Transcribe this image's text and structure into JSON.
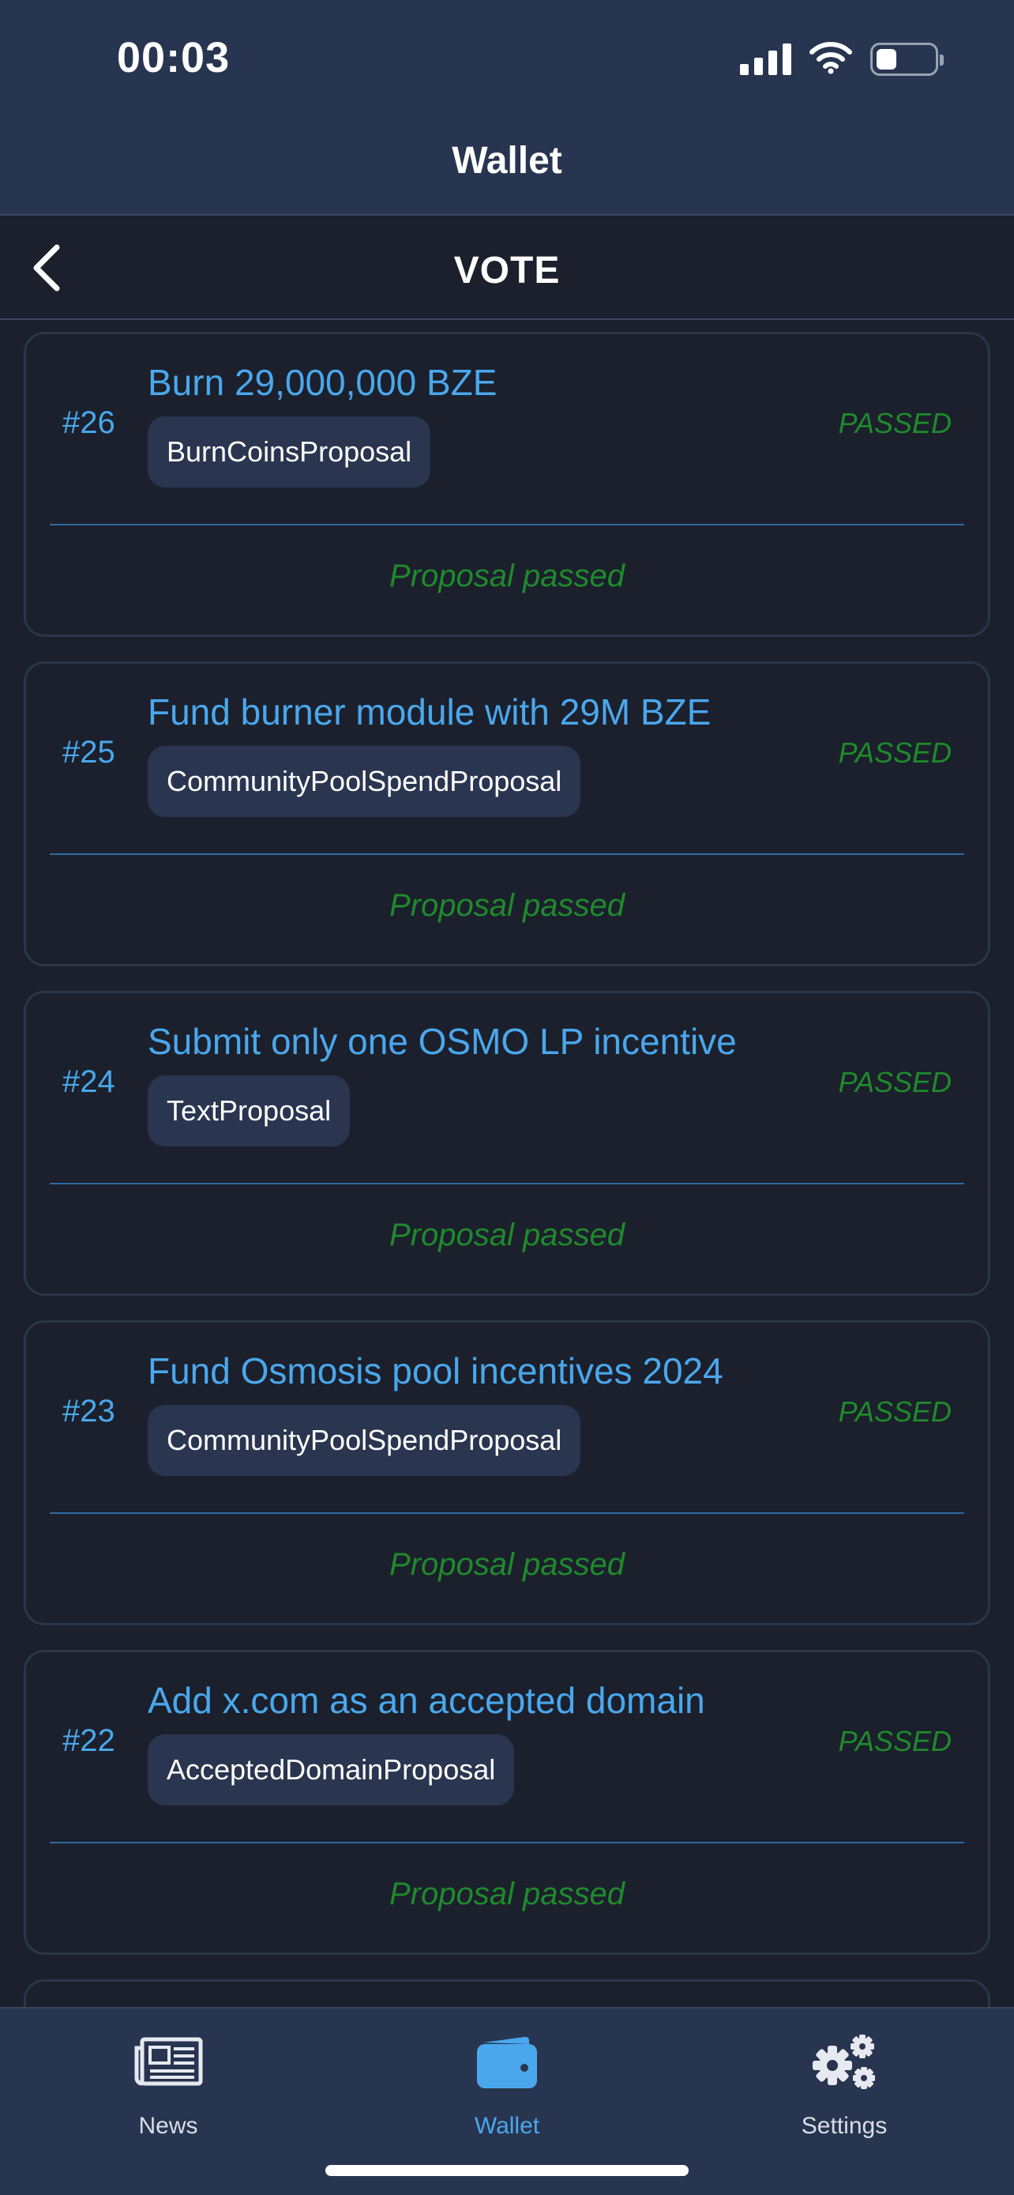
{
  "status_bar": {
    "time": "00:03",
    "battery_level": 0.35,
    "icons": [
      "signal-icon",
      "wifi-icon",
      "battery-icon"
    ]
  },
  "header": {
    "title": "Wallet"
  },
  "sub_nav": {
    "title": "VOTE",
    "back_icon": "chevron-left-icon"
  },
  "proposals": [
    {
      "id": "#26",
      "title": "Burn 29,000,000 BZE",
      "type": "BurnCoinsProposal",
      "status": "PASSED",
      "result": "Proposal passed"
    },
    {
      "id": "#25",
      "title": "Fund burner module with 29M BZE",
      "type": "CommunityPoolSpendProposal",
      "status": "PASSED",
      "result": "Proposal passed"
    },
    {
      "id": "#24",
      "title": "Submit only one OSMO LP incentive",
      "type": "TextProposal",
      "status": "PASSED",
      "result": "Proposal passed"
    },
    {
      "id": "#23",
      "title": "Fund Osmosis pool incentives 2024",
      "type": "CommunityPoolSpendProposal",
      "status": "PASSED",
      "result": "Proposal passed"
    },
    {
      "id": "#22",
      "title": "Add x.com as an accepted domain",
      "type": "AcceptedDomainProposal",
      "status": "PASSED",
      "result": "Proposal passed"
    }
  ],
  "tab_bar": {
    "tabs": [
      {
        "label": "News",
        "icon": "newspaper-icon",
        "active": false
      },
      {
        "label": "Wallet",
        "icon": "wallet-icon",
        "active": true
      },
      {
        "label": "Settings",
        "icon": "gears-icon",
        "active": false
      }
    ]
  },
  "colors": {
    "header_bg": "#283550",
    "page_bg": "#1b202c",
    "accent_blue": "#4aa7ec",
    "passed_green": "#1f8a2c",
    "chip_bg": "#2a3550"
  }
}
